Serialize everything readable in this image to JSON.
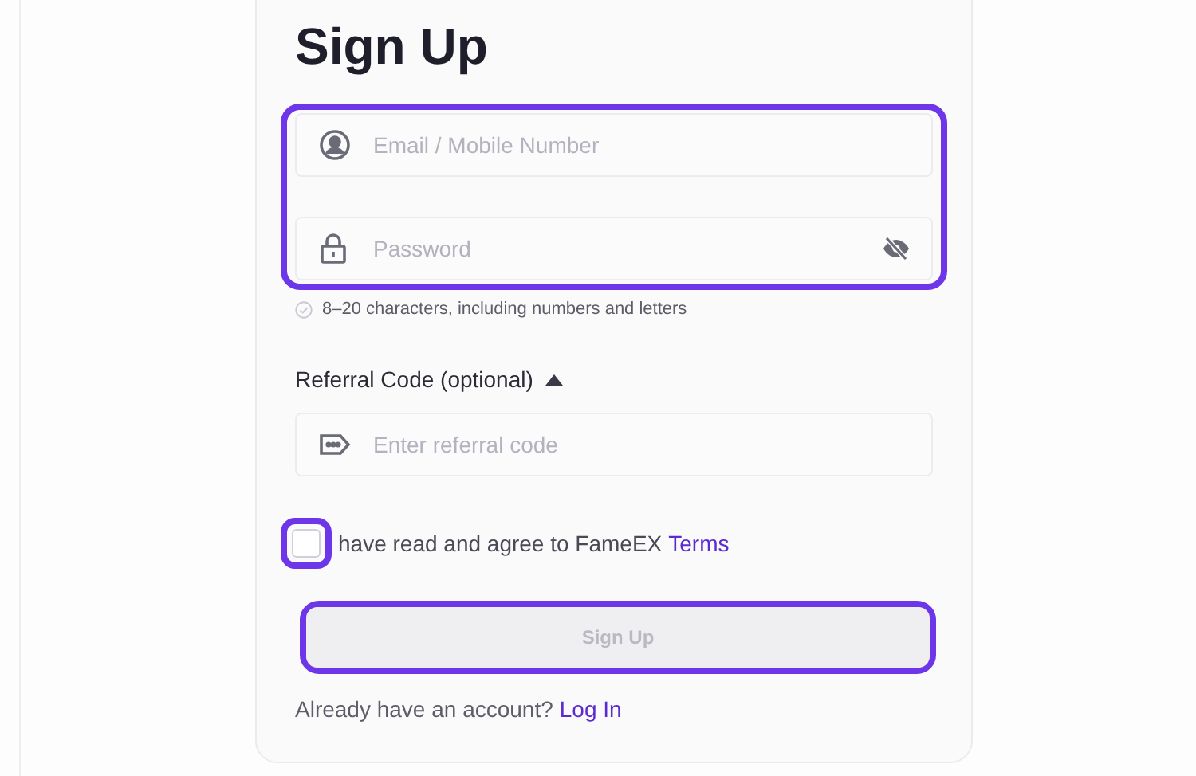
{
  "title": "Sign Up",
  "credentials": {
    "highlighted": true,
    "fields": [
      {
        "kind": "email",
        "placeholder": "Email / Mobile Number"
      },
      {
        "kind": "password",
        "placeholder": "Password"
      }
    ]
  },
  "password_hint": "8–20 characters, including numbers and letters",
  "referral": {
    "label": "Referral Code (optional)",
    "expanded": true,
    "placeholder": "Enter referral code"
  },
  "agreement": {
    "checked": false,
    "highlighted": true,
    "text": "have read and agree to FameEX",
    "link": "Terms"
  },
  "submit": {
    "label": "Sign Up",
    "disabled": true,
    "highlighted": true
  },
  "login_prompt": {
    "text": "Already have an account?",
    "link": "Log In"
  }
}
